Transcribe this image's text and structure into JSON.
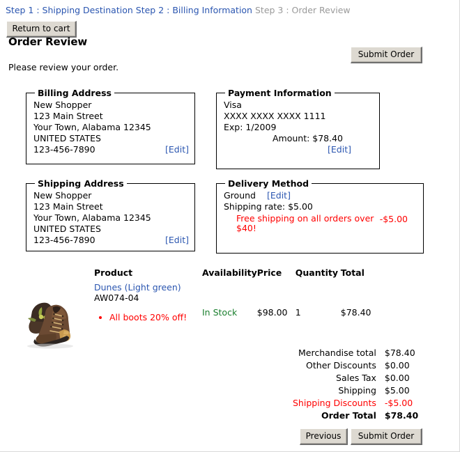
{
  "steps": {
    "step1": "Step 1 : Shipping Destination",
    "step2": "Step 2 : Billing Information",
    "step3": "Step 3 : Order Review"
  },
  "buttons": {
    "return_to_cart": "Return to cart",
    "submit_order_top": "Submit Order",
    "previous": "Previous",
    "submit_order_bottom": "Submit Order"
  },
  "page_title": "Order Review",
  "intro_text": "Please review your order.",
  "billing_address": {
    "legend": "Billing Address",
    "name": "New Shopper",
    "street": "123 Main Street",
    "city_state_zip": "Your Town, Alabama 12345",
    "country": "UNITED STATES",
    "phone": "123-456-7890",
    "edit": "[Edit]"
  },
  "shipping_address": {
    "legend": "Shipping Address",
    "name": "New Shopper",
    "street": "123 Main Street",
    "city_state_zip": "Your Town, Alabama 12345",
    "country": "UNITED STATES",
    "phone": "123-456-7890",
    "edit": "[Edit]"
  },
  "payment_information": {
    "legend": "Payment Information",
    "card_type": "Visa",
    "card_number": "XXXX XXXX XXXX 1111",
    "expiry": "Exp: 1/2009",
    "amount": "Amount: $78.40",
    "edit": "[Edit]"
  },
  "delivery_method": {
    "legend": "Delivery Method",
    "method": "Ground",
    "edit": "[Edit]",
    "shipping_rate": "Shipping rate: $5.00",
    "promo_text": "Free shipping on all orders over $40!",
    "promo_amount": "-$5.00"
  },
  "product_table": {
    "headers": {
      "product": "Product",
      "availability": "Availability",
      "price": "Price",
      "quantity": "Quantity",
      "total": "Total"
    },
    "rows": [
      {
        "image_alt": "hiking-boots",
        "name": "Dunes (Light green)",
        "sku": "AW074-04",
        "promo": "All boots 20% off!",
        "availability": "In Stock",
        "price": "$98.00",
        "quantity": "1",
        "total": "$78.40"
      }
    ]
  },
  "order_summary": [
    {
      "label": "Merchandise total",
      "value": "$78.40",
      "style": "normal"
    },
    {
      "label": "Other Discounts",
      "value": "$0.00",
      "style": "normal"
    },
    {
      "label": "Sales Tax",
      "value": "$0.00",
      "style": "normal"
    },
    {
      "label": "Shipping",
      "value": "$5.00",
      "style": "normal"
    },
    {
      "label": "Shipping Discounts",
      "value": "-$5.00",
      "style": "red"
    },
    {
      "label": "Order Total",
      "value": "$78.40",
      "style": "bold"
    }
  ],
  "colors": {
    "link": "#2b56b0",
    "current_step": "#9a9a9a",
    "promo_red": "#ff0000",
    "in_stock_green": "#1a7f2e",
    "button_face": "#ddd9d1"
  }
}
